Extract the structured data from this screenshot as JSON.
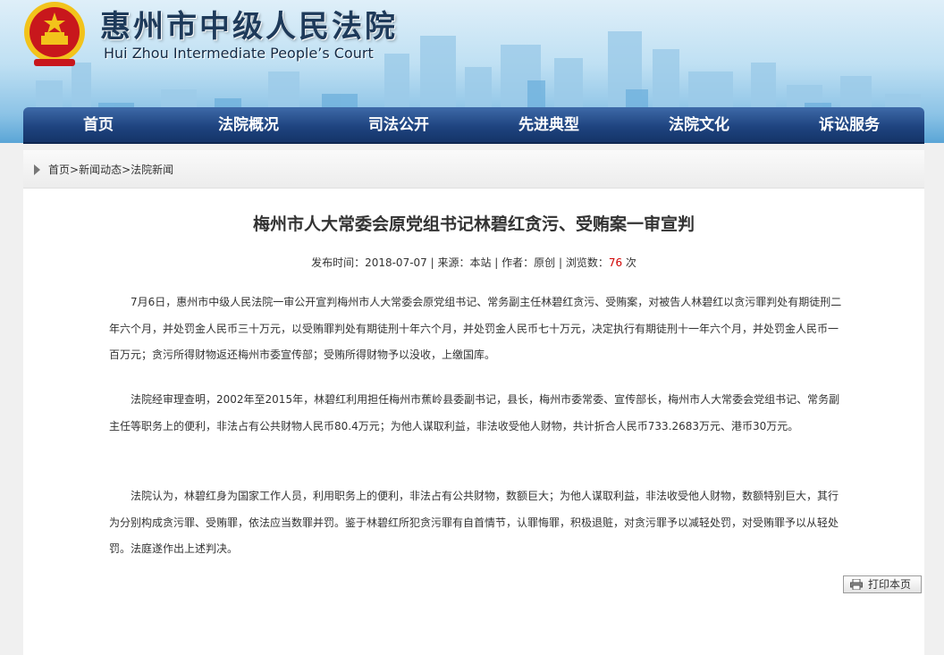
{
  "header": {
    "court_name_cn": "惠州市中级人民法院",
    "court_name_en": "Hui Zhou Intermediate People’s Court"
  },
  "nav": {
    "items": [
      {
        "label": "首页"
      },
      {
        "label": "法院概况"
      },
      {
        "label": "司法公开"
      },
      {
        "label": "先进典型"
      },
      {
        "label": "法院文化"
      },
      {
        "label": "诉讼服务"
      }
    ]
  },
  "breadcrumb": {
    "home": "首页",
    "sep1": ">",
    "section": "新闻动态",
    "sep2": ">",
    "current": "法院新闻"
  },
  "article": {
    "title": "梅州市人大常委会原党组书记林碧红贪污、受贿案一审宣判",
    "meta_prefix": "发布时间：2018-07-07 | 来源：本站 | 作者：原创 | 浏览数：",
    "views": "76",
    "views_suffix": " 次",
    "paragraphs": [
      "7月6日，惠州市中级人民法院一审公开宣判梅州市人大常委会原党组书记、常务副主任林碧红贪污、受贿案，对被告人林碧红以贪污罪判处有期徒刑二年六个月，并处罚金人民币三十万元，以受贿罪判处有期徒刑十年六个月，并处罚金人民币七十万元，决定执行有期徒刑十一年六个月，并处罚金人民币一百万元；贪污所得财物返还梅州市委宣传部；受贿所得财物予以没收，上缴国库。",
      "法院经审理查明，2002年至2015年，林碧红利用担任梅州市蕉岭县委副书记，县长，梅州市委常委、宣传部长，梅州市人大常委会党组书记、常务副主任等职务上的便利，非法占有公共财物人民币80.4万元；为他人谋取利益，非法收受他人财物，共计折合人民币733.2683万元、港币30万元。",
      "法院认为，林碧红身为国家工作人员，利用职务上的便利，非法占有公共财物，数额巨大；为他人谋取利益，非法收受他人财物，数额特别巨大，其行为分别构成贪污罪、受贿罪，依法应当数罪并罚。鉴于林碧红所犯贪污罪有自首情节，认罪悔罪，积极退赃，对贪污罪予以减轻处罚，对受贿罪予以从轻处罚。法庭遂作出上述判决。"
    ]
  },
  "print_button": {
    "label": "打印本页"
  },
  "colors": {
    "nav_bg": "#1f4480",
    "views_highlight": "#d00000",
    "emblem_red": "#c8171c",
    "emblem_gold": "#f2c31b"
  }
}
